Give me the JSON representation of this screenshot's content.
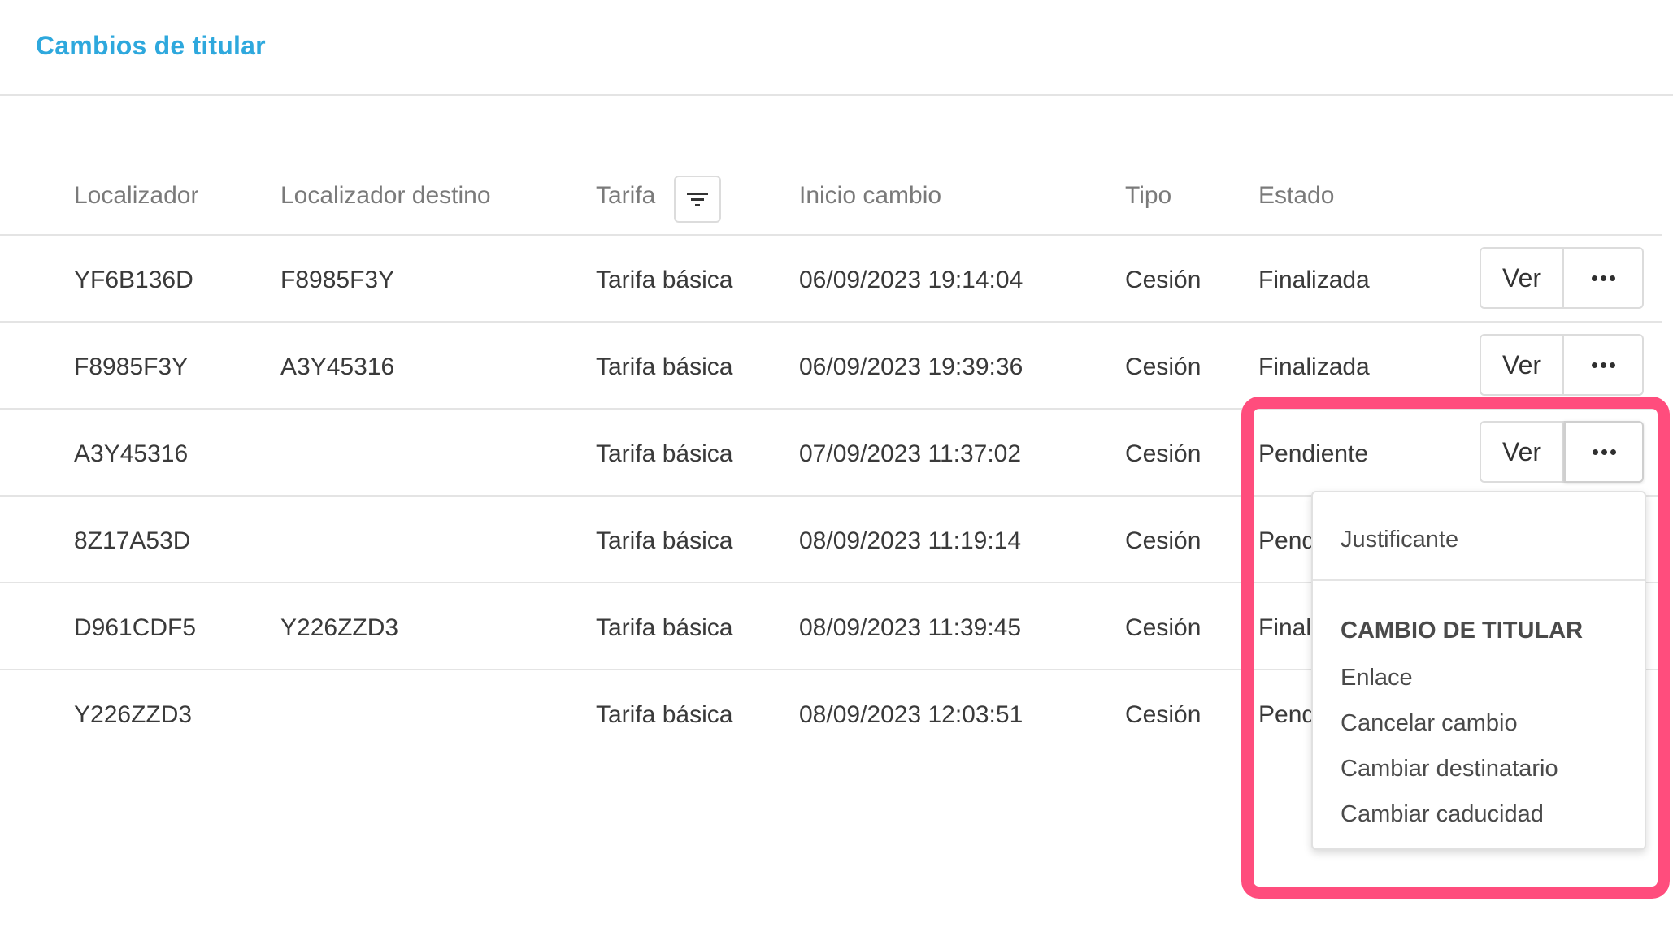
{
  "page": {
    "title": "Cambios de titular"
  },
  "table": {
    "headers": {
      "localizador": "Localizador",
      "destino": "Localizador destino",
      "tarifa": "Tarifa",
      "inicio": "Inicio cambio",
      "tipo": "Tipo",
      "estado": "Estado"
    },
    "rows": [
      {
        "localizador": "YF6B136D",
        "destino": "F8985F3Y",
        "tarifa": "Tarifa básica",
        "inicio": "06/09/2023 19:14:04",
        "tipo": "Cesión",
        "estado": "Finalizada"
      },
      {
        "localizador": "F8985F3Y",
        "destino": "A3Y45316",
        "tarifa": "Tarifa básica",
        "inicio": "06/09/2023 19:39:36",
        "tipo": "Cesión",
        "estado": "Finalizada"
      },
      {
        "localizador": "A3Y45316",
        "destino": "",
        "tarifa": "Tarifa básica",
        "inicio": "07/09/2023 11:37:02",
        "tipo": "Cesión",
        "estado": "Pendiente"
      },
      {
        "localizador": "8Z17A53D",
        "destino": "",
        "tarifa": "Tarifa básica",
        "inicio": "08/09/2023 11:19:14",
        "tipo": "Cesión",
        "estado": "Pend"
      },
      {
        "localizador": "D961CDF5",
        "destino": "Y226ZZD3",
        "tarifa": "Tarifa básica",
        "inicio": "08/09/2023 11:39:45",
        "tipo": "Cesión",
        "estado": "Finali"
      },
      {
        "localizador": "Y226ZZD3",
        "destino": "",
        "tarifa": "Tarifa básica",
        "inicio": "08/09/2023 12:03:51",
        "tipo": "Cesión",
        "estado": "Pend"
      }
    ],
    "view_label": "Ver"
  },
  "menu": {
    "justificante": "Justificante",
    "section_heading": "CAMBIO DE TITULAR",
    "items": [
      "Enlace",
      "Cancelar cambio",
      "Cambiar destinatario",
      "Cambiar caducidad"
    ]
  },
  "colors": {
    "title": "#2ea8dd",
    "highlight": "#ff4d7d",
    "divider": "#e4e4e4"
  },
  "icons": {
    "filter": "filter-icon",
    "more": "more-horizontal-icon"
  }
}
